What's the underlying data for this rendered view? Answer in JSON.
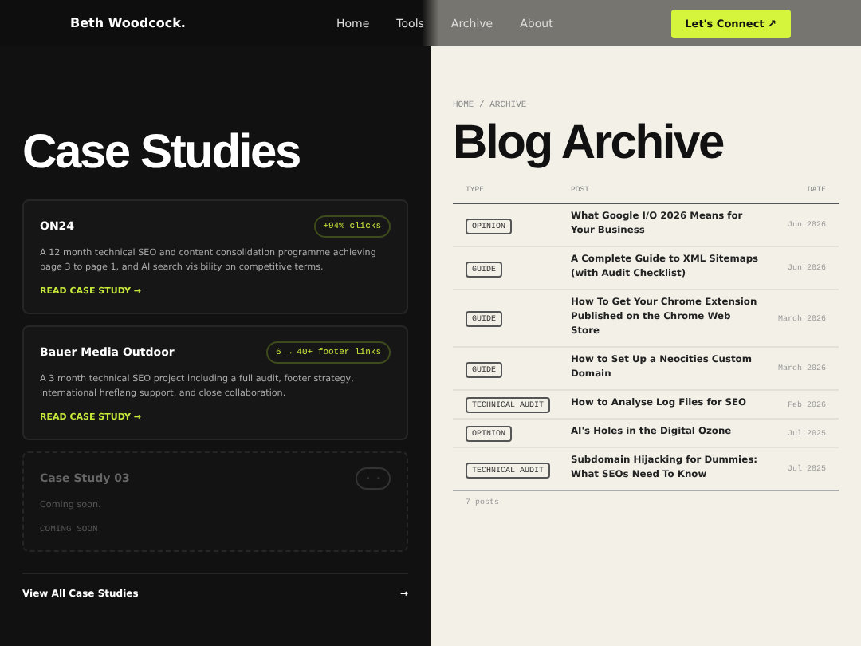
{
  "header": {
    "brand": "Beth Woodcock.",
    "nav": [
      "Home",
      "Tools",
      "Archive",
      "About"
    ],
    "cta": "Let's Connect ↗"
  },
  "case_studies": {
    "title": "Case Studies",
    "cards": [
      {
        "title": "ON24",
        "badge": "+94% clicks",
        "description": "A 12 month technical SEO and content consolidation programme achieving page 3 to page 1, and AI search visibility on competitive terms.",
        "link": "READ CASE STUDY →",
        "disabled": false
      },
      {
        "title": "Bauer Media Outdoor",
        "badge": "6 → 40+ footer links",
        "description": "A 3 month technical SEO project including a full audit, footer strategy, international hreflang support, and close collaboration.",
        "link": "READ CASE STUDY →",
        "disabled": false
      },
      {
        "title": "Case Study 03",
        "badge": "- -",
        "description": "Coming soon.",
        "link": "COMING SOON",
        "disabled": true
      }
    ],
    "view_all": "View All Case Studies",
    "view_all_arrow": "→"
  },
  "archive": {
    "breadcrumb": "HOME / ARCHIVE",
    "title": "Blog Archive",
    "columns": [
      "TYPE",
      "POST",
      "DATE"
    ],
    "rows": [
      {
        "type": "OPINION",
        "post": "What Google I/O 2026 Means for Your Business",
        "date": "Jun 2026"
      },
      {
        "type": "GUIDE",
        "post": "A Complete Guide to XML Sitemaps (with Audit Checklist)",
        "date": "Jun 2026"
      },
      {
        "type": "GUIDE",
        "post": "How To Get Your Chrome Extension Published on the Chrome Web Store",
        "date": "March 2026"
      },
      {
        "type": "GUIDE",
        "post": "How to Set Up a Neocities Custom Domain",
        "date": "March 2026"
      },
      {
        "type": "TECHNICAL AUDIT",
        "post": "How to Analyse Log Files for SEO",
        "date": "Feb 2026"
      },
      {
        "type": "OPINION",
        "post": "AI's Holes in the Digital Ozone",
        "date": "Jul 2025"
      },
      {
        "type": "TECHNICAL AUDIT",
        "post": "Subdomain Hijacking for Dummies: What SEOs Need To Know",
        "date": "Jul 2025"
      }
    ],
    "count": "7 posts"
  }
}
